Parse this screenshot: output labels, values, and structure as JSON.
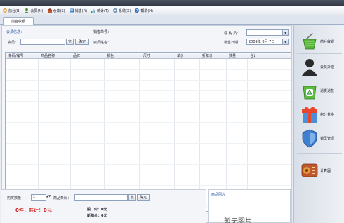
{
  "menu": [
    {
      "label": "前台(B)",
      "icon": "cashier-icon"
    },
    {
      "label": "会员(M)",
      "icon": "member-icon"
    },
    {
      "label": "仓库(S)",
      "icon": "warehouse-icon"
    },
    {
      "label": "销售(R)",
      "icon": "sales-icon"
    },
    {
      "label": "统计(T)",
      "icon": "stats-icon"
    },
    {
      "label": "系统(X)",
      "icon": "system-icon"
    },
    {
      "label": "帮助(H)",
      "icon": "help-icon"
    }
  ],
  "tab": {
    "label": "前台收银"
  },
  "header": {
    "member_info_label": "会员信息：",
    "sales_no_label": "销售单号：",
    "member_label": "会员：",
    "member_value": "",
    "browse_button": "览",
    "confirm_button": "确定",
    "member_name_label": "会员姓名：",
    "shopping_guide_label": "导 购 员：",
    "shopping_guide_value": "",
    "sales_date_label": "销售日期：",
    "sales_date_value": "2009年 8月 7日"
  },
  "table": {
    "columns": [
      "条码/编号",
      "商品名称",
      "品牌",
      "颜色",
      "尺寸",
      "单价",
      "折扣价",
      "数量",
      "合计"
    ]
  },
  "bottom": {
    "qty_label": "购买数量：",
    "qty_value": "1",
    "barcode_label": "商品条码：",
    "barcode_value": "",
    "browse_button": "览",
    "confirm_button": "确定",
    "total_text": "0件，共计：0元",
    "stock_label": "股　价：0元",
    "discount_label": "新扣价：0元"
  },
  "image_panel": {
    "title": "商品图片",
    "empty_text": "暂无图片"
  },
  "sidebar": [
    {
      "label": "前台收银",
      "icon": "shopping-basket-icon"
    },
    {
      "label": "会员办理",
      "icon": "member-silhouette-icon"
    },
    {
      "label": "退货退款",
      "icon": "recycle-basket-icon"
    },
    {
      "label": "积分兑换",
      "icon": "gift-box-icon"
    },
    {
      "label": "锁屏管理",
      "icon": "shield-icon"
    },
    {
      "label": "计算器",
      "icon": "calculator-radio-icon"
    }
  ],
  "colors": {
    "accent_blue": "#2d58a8",
    "total_red": "#d11818",
    "titlebar": "#3a414d"
  }
}
